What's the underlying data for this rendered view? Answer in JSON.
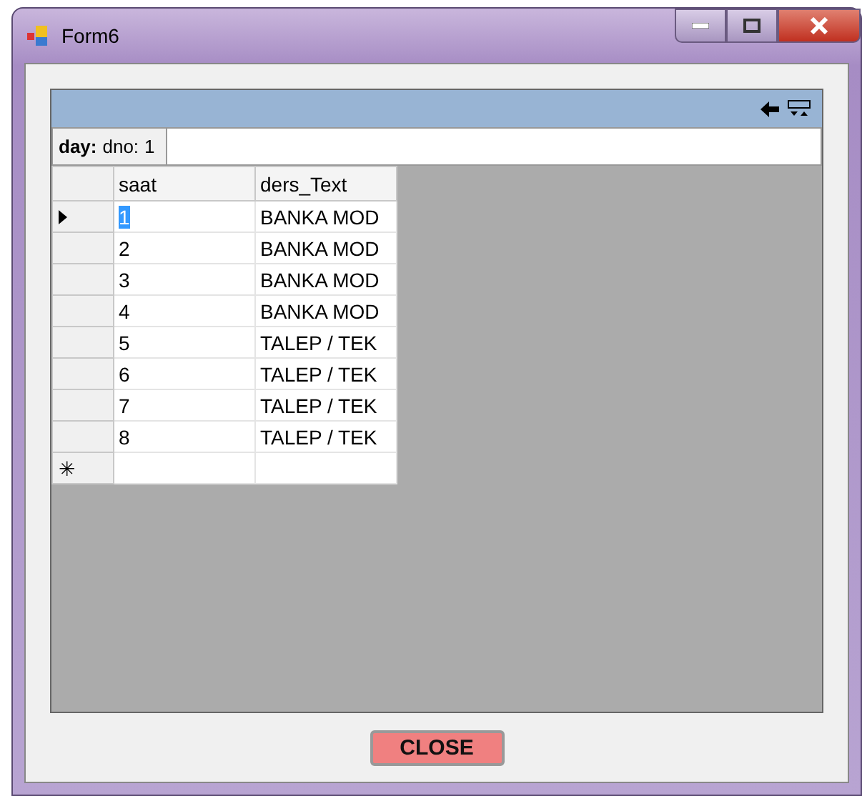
{
  "window": {
    "title": "Form6"
  },
  "header_panel": {
    "title": "day:",
    "field_label": "dno:",
    "field_value": "1"
  },
  "table": {
    "columns": [
      "saat",
      "ders_Text"
    ],
    "rows": [
      {
        "cells": [
          "1",
          "BANKA MOD"
        ],
        "selected": true
      },
      {
        "cells": [
          "2",
          "BANKA MOD"
        ],
        "selected": false
      },
      {
        "cells": [
          "3",
          "BANKA MOD"
        ],
        "selected": false
      },
      {
        "cells": [
          "4",
          "BANKA MOD"
        ],
        "selected": false
      },
      {
        "cells": [
          "5",
          "TALEP / TEK"
        ],
        "selected": false
      },
      {
        "cells": [
          "6",
          "TALEP / TEK"
        ],
        "selected": false
      },
      {
        "cells": [
          "7",
          "TALEP / TEK"
        ],
        "selected": false
      },
      {
        "cells": [
          "8",
          "TALEP / TEK"
        ],
        "selected": false
      }
    ],
    "new_row_marker": "✳"
  },
  "buttons": [
    {
      "label": "CLOSE"
    }
  ]
}
